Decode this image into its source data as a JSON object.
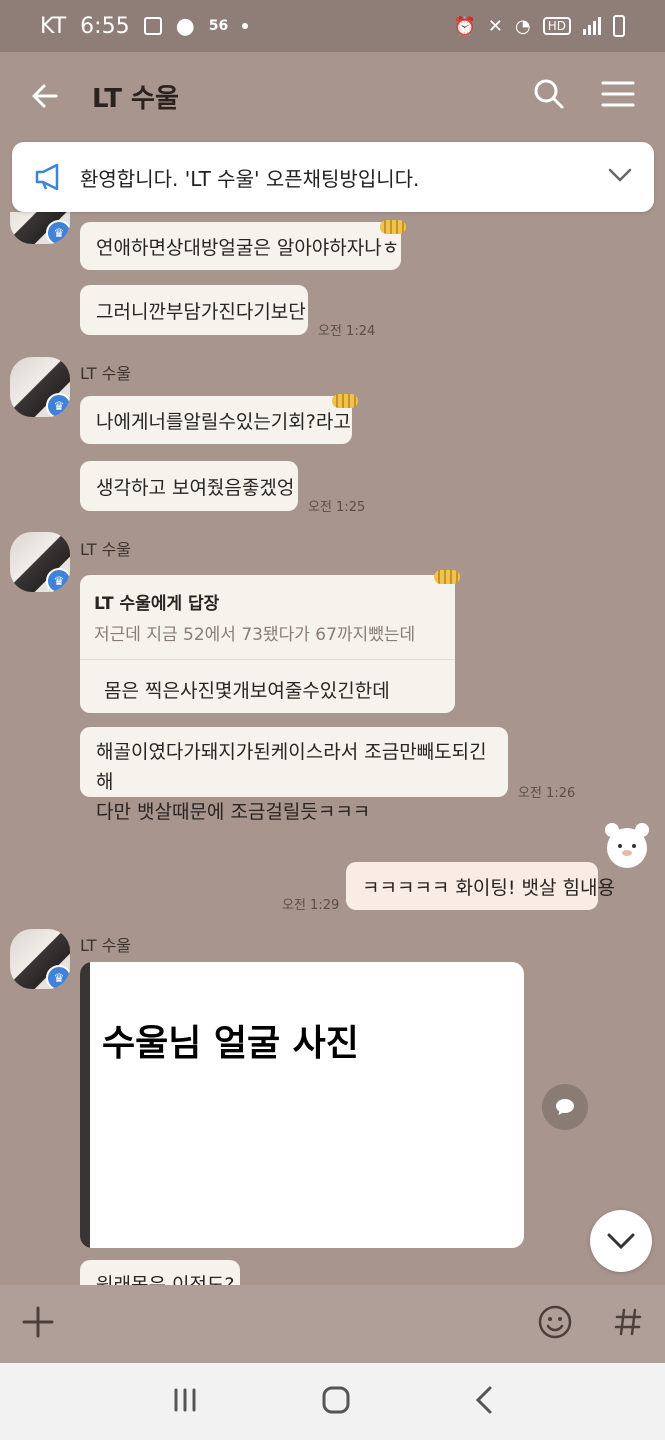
{
  "status_bar": {
    "carrier": "KT",
    "time": "6:55",
    "network": "56",
    "hd": "HD"
  },
  "header": {
    "title": "LT 수울"
  },
  "notice": {
    "text": "환영합니다. 'LT 수울' 오픈채팅방입니다."
  },
  "messages": {
    "m1": "연애하면상대방얼굴은 알아야하자나ㅎ",
    "m2": "그러니깐부담가진다기보단",
    "t1": "오전 1:24",
    "sender": "LT 수울",
    "m3": "나에게너를알릴수있는기회?라고",
    "m4": "생각하고 보여줬음좋겠엉",
    "t2": "오전 1:25",
    "reply_header": "LT 수울에게 답장",
    "reply_quote": "저근데 지금 52에서 73됐다가 67까지뺐는데",
    "reply_body": "몸은 찍은사진몇개보여줄수있긴한데",
    "m5_line1": "해골이였다가돼지가된케이스라서 조금만빼도되긴해",
    "m5_line2": "다만 뱃살때문에 조금걸릴듯ㅋㅋㅋ",
    "t3": "오전 1:26",
    "my_msg": "ㅋㅋㅋㅋㅋ 화이팅! 뱃살 힘내용",
    "t4": "오전 1:29",
    "photo_text": "수울님 얼굴 사진",
    "m6_partial": "원래몸은 이정도?"
  },
  "icons": {
    "back": "arrow-left-icon",
    "search": "search-icon",
    "menu": "hamburger-menu-icon",
    "megaphone": "megaphone-icon",
    "chevron": "chevron-down-icon",
    "crown": "crown-icon",
    "share": "chat-bubble-icon",
    "add": "plus-icon",
    "emoji": "smiley-icon",
    "hash": "hash-icon",
    "recent": "recent-apps-icon",
    "home": "home-icon",
    "nav_back": "nav-back-icon"
  },
  "colors": {
    "background": "#a8958e",
    "bubble": "#f6f2ec",
    "my_bubble": "#f8ece5",
    "badge": "#3f82d8"
  }
}
